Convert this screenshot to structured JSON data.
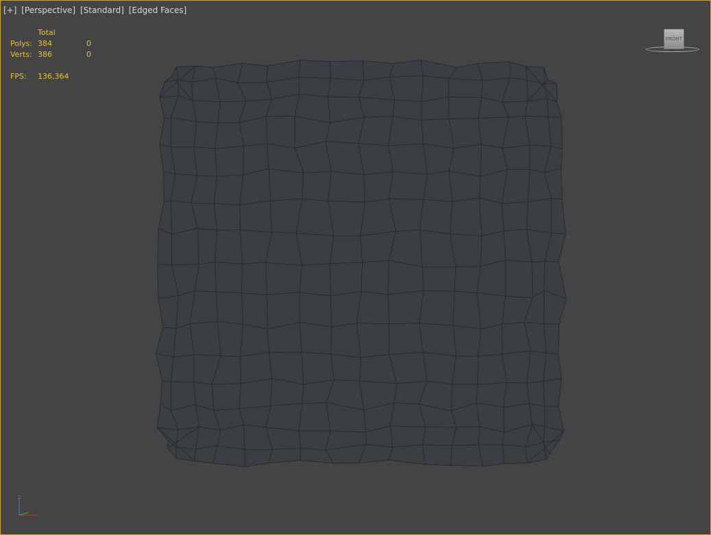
{
  "viewport": {
    "labels": [
      "[+]",
      "[Perspective]",
      "[Standard]",
      "[Edged Faces]"
    ]
  },
  "stats": {
    "header": "Total",
    "polys_label": "Polys:",
    "polys_total": "384",
    "polys_selected": "0",
    "verts_label": "Verts:",
    "verts_total": "386",
    "verts_selected": "0",
    "fps_label": "FPS:",
    "fps_value": "136,364"
  },
  "viewcube": {
    "face_label": "FRONT"
  },
  "axis": {
    "z_label": "Z"
  },
  "colors": {
    "background": "#444444",
    "border": "#c8a52a",
    "mesh_wire": "#262a36",
    "mesh_fill": "#3c3f42",
    "stats_text": "#e8c23a"
  }
}
